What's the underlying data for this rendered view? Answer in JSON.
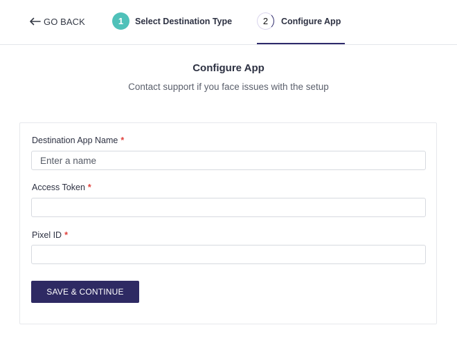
{
  "header": {
    "back_label": "GO BACK",
    "steps": [
      {
        "number": "1",
        "label": "Select Destination Type",
        "state": "completed"
      },
      {
        "number": "2",
        "label": "Configure App",
        "state": "active"
      }
    ]
  },
  "main": {
    "title": "Configure App",
    "subtitle": "Contact support if you face issues with the setup"
  },
  "form": {
    "fields": [
      {
        "label": "Destination App Name",
        "required_mark": "*",
        "placeholder": "Enter a name",
        "value": ""
      },
      {
        "label": "Access Token",
        "required_mark": "*",
        "placeholder": "",
        "value": ""
      },
      {
        "label": "Pixel ID",
        "required_mark": "*",
        "placeholder": "",
        "value": ""
      }
    ],
    "submit_label": "SAVE & CONTINUE"
  },
  "colors": {
    "primary": "#2e2a63",
    "step_completed": "#4fc1b9",
    "required": "#e0413c"
  }
}
